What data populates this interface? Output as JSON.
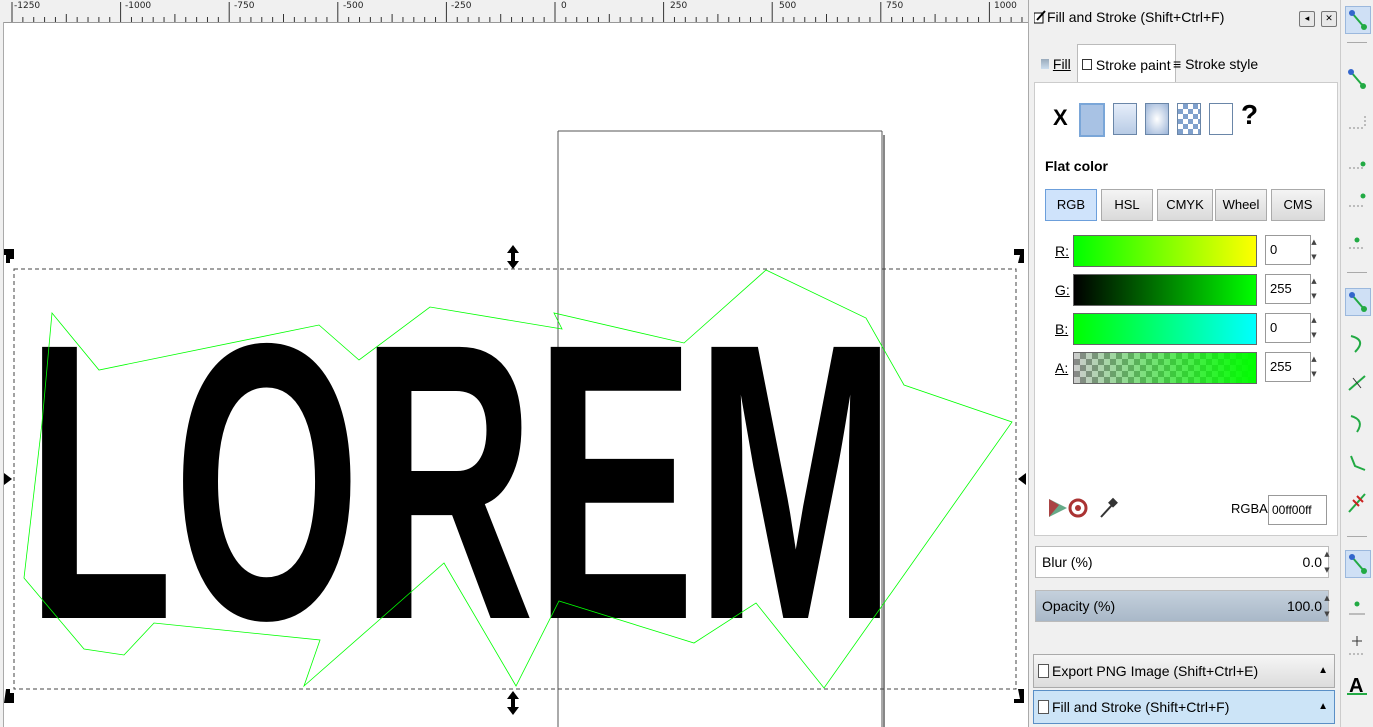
{
  "ruler": {
    "labels": [
      "-1250",
      "-1000",
      "-750",
      "-500",
      "-250",
      "0",
      "250",
      "500",
      "750",
      "1000"
    ]
  },
  "canvas": {
    "text": "LOREM",
    "text_fill": "#000000",
    "outline_color": "#00ff00"
  },
  "dialog": {
    "title": "Fill and Stroke (Shift+Ctrl+F)",
    "tabs": [
      {
        "label": "Fill"
      },
      {
        "label": "Stroke paint"
      },
      {
        "label": "Stroke style"
      }
    ],
    "no_paint_symbol": "X",
    "unset_symbol": "?",
    "mode_label": "Flat color",
    "color_modes": [
      "RGB",
      "HSL",
      "CMYK",
      "Wheel",
      "CMS"
    ],
    "channels": [
      {
        "label": "R:",
        "value": "0"
      },
      {
        "label": "G:",
        "value": "255"
      },
      {
        "label": "B:",
        "value": "0"
      },
      {
        "label": "A:",
        "value": "255"
      }
    ],
    "rgba_label": "RGBA:",
    "rgba_value": "00ff00ff",
    "blur_label": "Blur (%)",
    "blur_value": "0.0",
    "opacity_label": "Opacity (%)",
    "opacity_value": "100.0",
    "opacity_fraction": 1.0
  },
  "dock": {
    "export_label": "Export PNG Image (Shift+Ctrl+E)",
    "fill_stroke_label": "Fill and Stroke (Shift+Ctrl+F)"
  },
  "snap_icons": [
    "snap-enable-icon",
    "snap-bbox-icon",
    "snap-bbox-edge-icon",
    "snap-bbox-corner-icon",
    "snap-bbox-midpoint-icon",
    "snap-bbox-center-icon",
    "snap-nodes-icon",
    "snap-path-icon",
    "snap-path-intersection-icon",
    "snap-cusp-nodes-icon",
    "snap-smooth-nodes-icon",
    "snap-line-midpoint-icon",
    "snap-others-icon",
    "snap-object-center-icon",
    "snap-rotation-center-icon",
    "snap-text-baseline-icon"
  ]
}
